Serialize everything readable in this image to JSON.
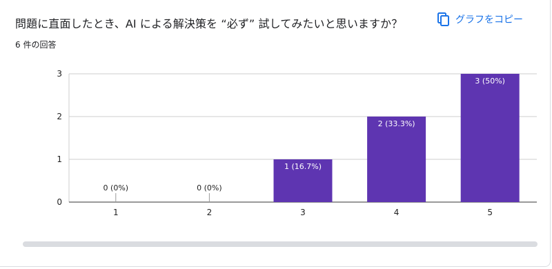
{
  "question": {
    "title": "問題に直面したとき、AI による解決策を “必ず” 試してみたいと思いますか？",
    "response_count": "6 件の回答"
  },
  "toolbar": {
    "copy_label": "グラフをコピー",
    "copy_icon": "copy-icon"
  },
  "colors": {
    "bar": "#5e35b1",
    "accent": "#1a73e8"
  },
  "chart_data": {
    "type": "bar",
    "categories": [
      "1",
      "2",
      "3",
      "4",
      "5"
    ],
    "values": [
      0,
      0,
      1,
      2,
      3
    ],
    "data_labels": [
      "0 (0%)",
      "0 (0%)",
      "1 (16.7%)",
      "2 (33.3%)",
      "3 (50%)"
    ],
    "y_ticks": [
      "0",
      "1",
      "2",
      "3"
    ],
    "ylim": [
      0,
      3
    ],
    "grid": true,
    "title": "",
    "xlabel": "",
    "ylabel": ""
  }
}
